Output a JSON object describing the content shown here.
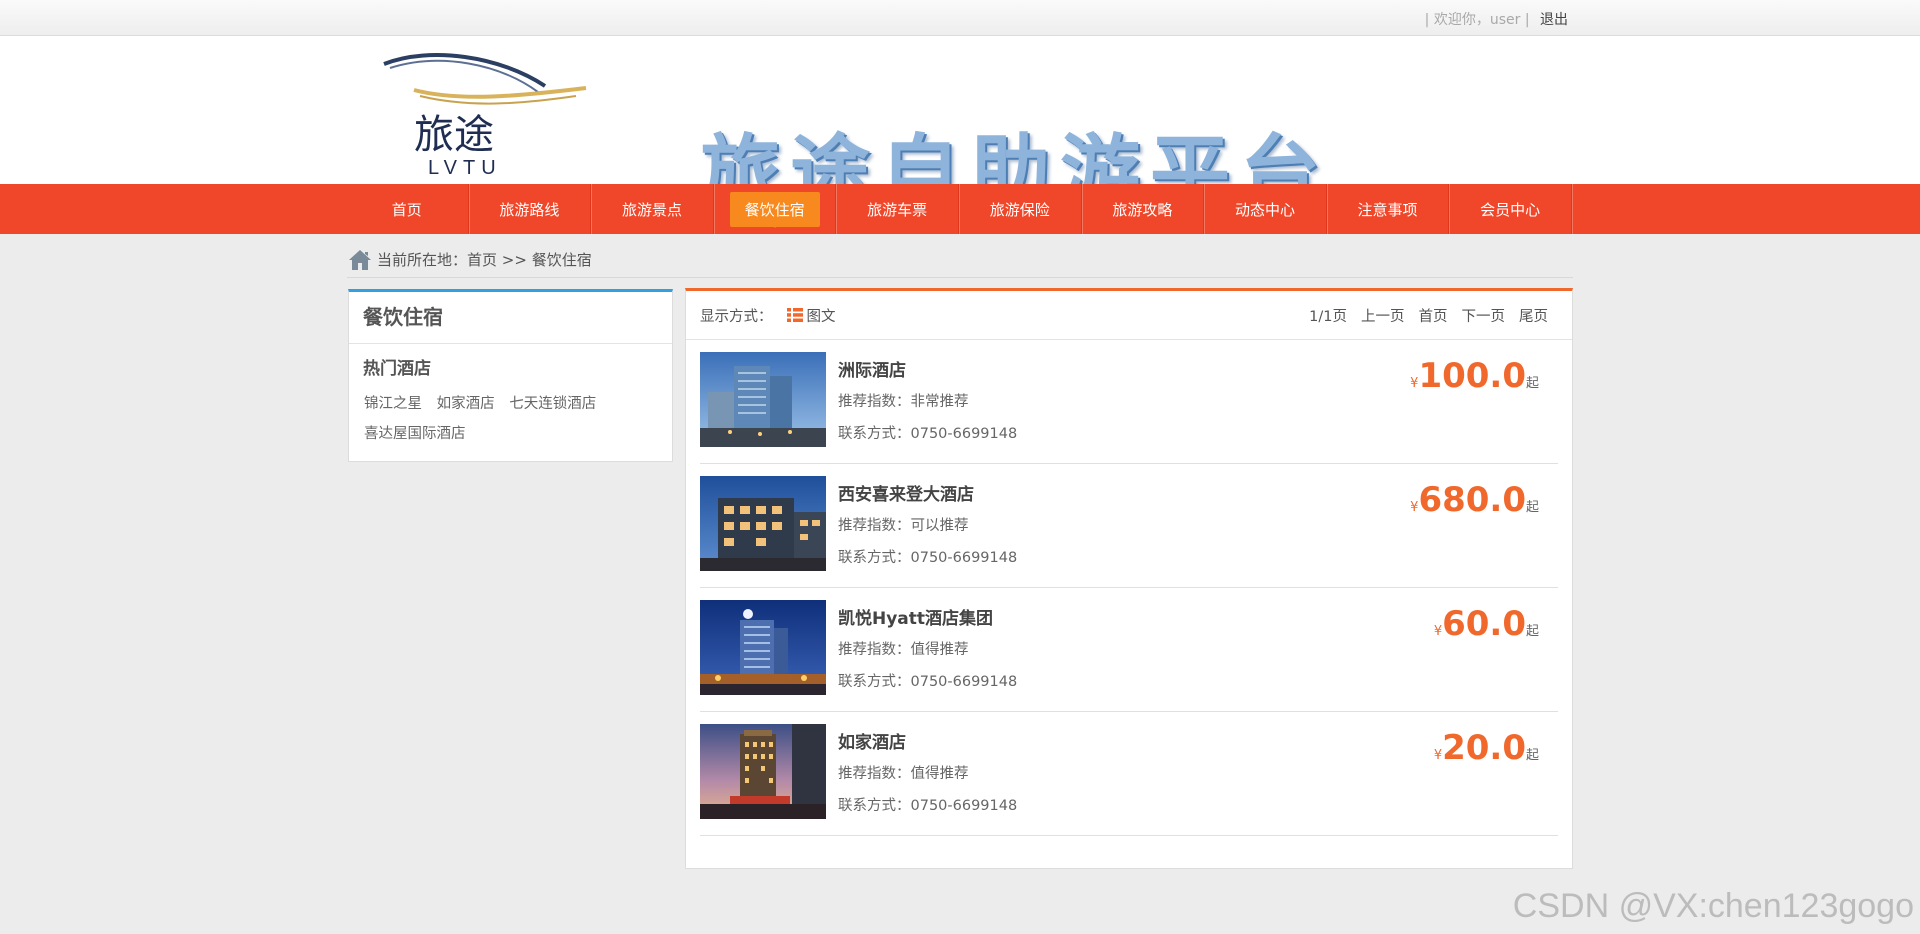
{
  "topbar": {
    "welcome": "| 欢迎你，user |",
    "logout": "退出"
  },
  "header": {
    "logo_text_cn": "旅途",
    "logo_text_en": "LVTU",
    "banner_title": "旅途自助游平台"
  },
  "nav": {
    "items": [
      {
        "label": "首页"
      },
      {
        "label": "旅游路线"
      },
      {
        "label": "旅游景点"
      },
      {
        "label": "餐饮住宿"
      },
      {
        "label": "旅游车票"
      },
      {
        "label": "旅游保险"
      },
      {
        "label": "旅游攻略"
      },
      {
        "label": "动态中心"
      },
      {
        "label": "注意事项"
      },
      {
        "label": "会员中心"
      }
    ],
    "active_index": 3
  },
  "breadcrumb": {
    "prefix": "当前所在地：",
    "home": "首页",
    "sep": " >> ",
    "current": "餐饮住宿"
  },
  "sidebar": {
    "title": "餐饮住宿",
    "subtitle": "热门酒店",
    "tags": [
      "锦江之星",
      "如家酒店",
      "七天连锁酒店",
      "喜达屋国际酒店"
    ]
  },
  "main": {
    "display_label": "显示方式：",
    "view_mode": "图文",
    "pager": {
      "info": "1/1页",
      "prev": "上一页",
      "first": "首页",
      "next": "下一页",
      "last": "尾页"
    },
    "items": [
      {
        "name": "洲际酒店",
        "rating": "推荐指数：非常推荐",
        "contact": "联系方式：0750-6699148",
        "currency": "¥",
        "price": "100.0",
        "suffix": "起"
      },
      {
        "name": "西安喜来登大酒店",
        "rating": "推荐指数：可以推荐",
        "contact": "联系方式：0750-6699148",
        "currency": "¥",
        "price": "680.0",
        "suffix": "起"
      },
      {
        "name": "凯悦Hyatt酒店集团",
        "rating": "推荐指数：值得推荐",
        "contact": "联系方式：0750-6699148",
        "currency": "¥",
        "price": "60.0",
        "suffix": "起"
      },
      {
        "name": "如家酒店",
        "rating": "推荐指数：值得推荐",
        "contact": "联系方式：0750-6699148",
        "currency": "¥",
        "price": "20.0",
        "suffix": "起"
      }
    ]
  },
  "watermark": "CSDN @VX:chen123gogo",
  "colors": {
    "nav_bg": "#f0472a",
    "nav_active": "#f7891e",
    "price": "#f0682c",
    "sidebar_accent": "#2fa1e0",
    "main_accent": "#f0682c"
  }
}
